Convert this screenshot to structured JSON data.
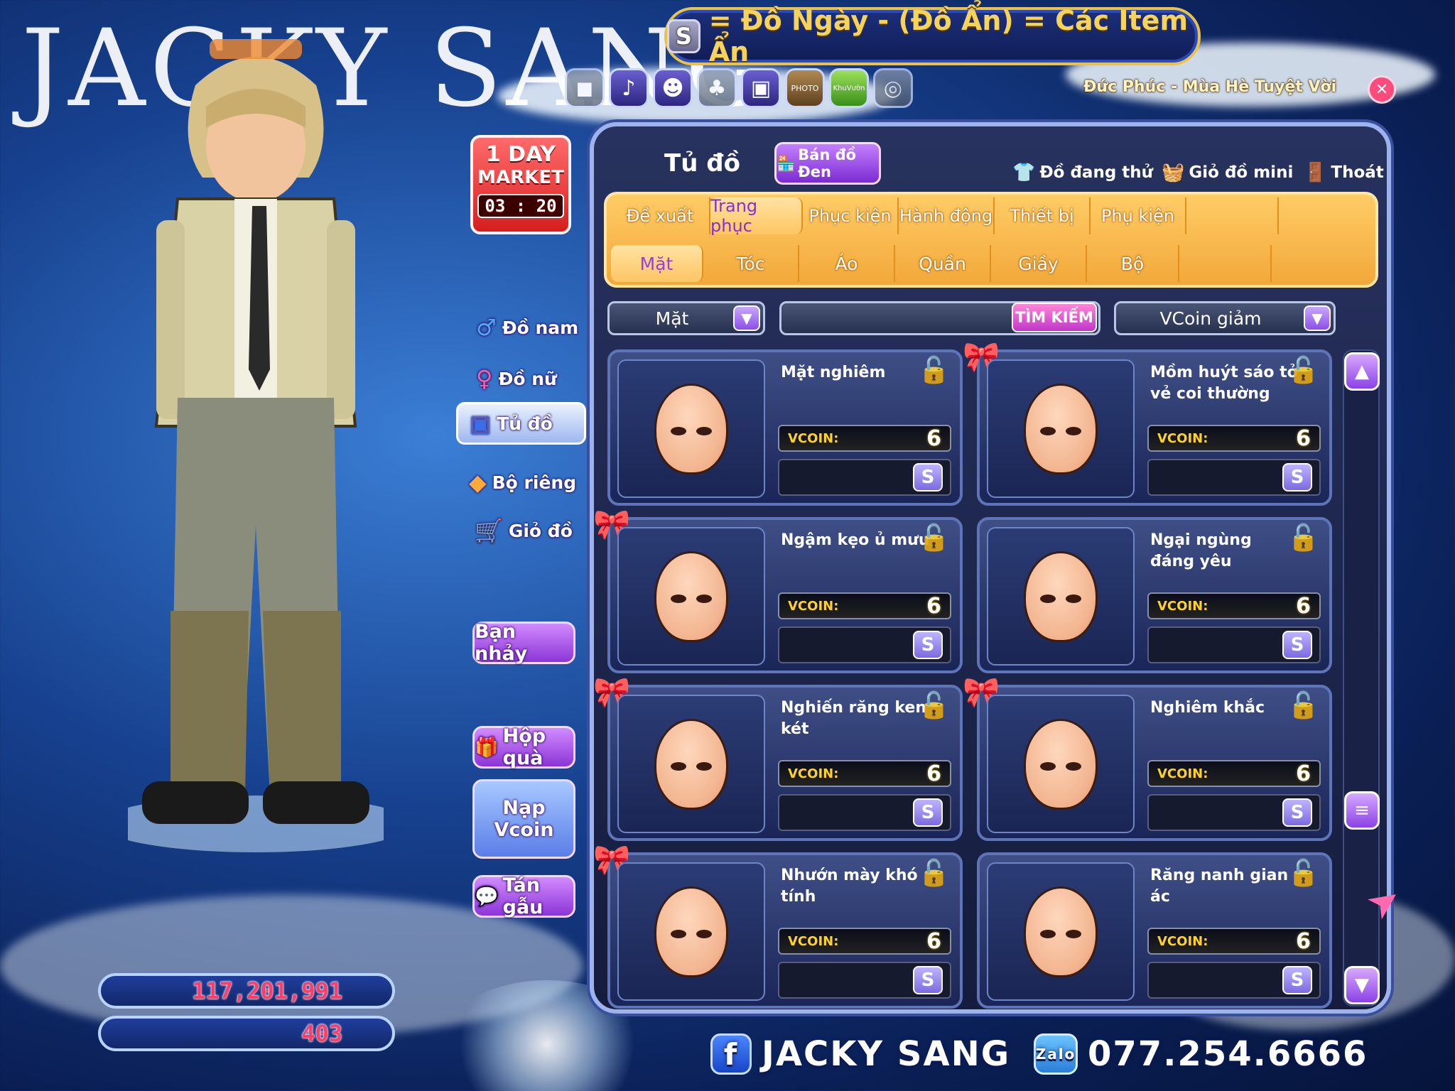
{
  "background": {
    "logo_text": "JACKY SANG"
  },
  "top_banner": {
    "badge": "S",
    "text": "= Đồ Ngày  -  (Đồ Ẩn) = Các Item Ẩn"
  },
  "top_icons": [
    "bag-icon",
    "horn-icon",
    "fish-icon",
    "mask-icon",
    "tv-icon",
    "photo-icon",
    "garden-icon",
    "spiral-icon"
  ],
  "top_icon_labels": {
    "photo": "PHOTO",
    "garden": "KhuVườn"
  },
  "song": "Đức Phúc - Mùa Hè Tuyệt Vời",
  "market": {
    "line1": "1 DAY",
    "line2": "MARKET",
    "timer": "03 : 20"
  },
  "side_menu": {
    "do_nam": "Đồ nam",
    "do_nu": "Đồ nữ",
    "tu_do": "Tủ đồ",
    "bo_rieng": "Bộ riêng",
    "gio_do": "Giỏ đồ"
  },
  "buttons": {
    "ban_nhay": "Bạn nhảy",
    "hop_qua": "Hộp quà",
    "nap_vcoin_1": "Nạp",
    "nap_vcoin_2": "Vcoin",
    "tan_gau": "Tán gẫu"
  },
  "stats": {
    "money": "117,201,991",
    "vcoin": "403"
  },
  "panel": {
    "title": "Tủ đồ",
    "hidden_btn": "Bán đồ Đen",
    "do_dang_thu": "Đồ đang thử",
    "gio_do_mini": "Giỏ đồ mini",
    "thoat": "Thoát"
  },
  "tabs": [
    "Đề xuất",
    "Trang phục",
    "Phục kiện",
    "Hành động",
    "Thiết bị",
    "Phụ kiện"
  ],
  "active_tab": "Trang phục",
  "subtabs": [
    "Mặt",
    "Tóc",
    "Áo",
    "Quần",
    "Giầy",
    "Bộ"
  ],
  "active_subtab": "Mặt",
  "filters": {
    "category": "Mặt",
    "search_button": "TÌM KIẾM",
    "sort": "VCoin giảm"
  },
  "items": [
    {
      "name": "Mặt nghiêm",
      "price_label": "VCOIN:",
      "price": "6",
      "buy": "S"
    },
    {
      "name": "Mồm huýt sáo tỏ vẻ coi thường",
      "price_label": "VCOIN:",
      "price": "6",
      "buy": "S"
    },
    {
      "name": "Ngậm kẹo ủ mưu",
      "price_label": "VCOIN:",
      "price": "6",
      "buy": "S"
    },
    {
      "name": "Ngại ngùng đáng yêu",
      "price_label": "VCOIN:",
      "price": "6",
      "buy": "S"
    },
    {
      "name": "Nghiến răng ken két",
      "price_label": "VCOIN:",
      "price": "6",
      "buy": "S"
    },
    {
      "name": "Nghiêm khắc",
      "price_label": "VCOIN:",
      "price": "6",
      "buy": "S"
    },
    {
      "name": "Nhướn mày khó tính",
      "price_label": "VCOIN:",
      "price": "6",
      "buy": "S"
    },
    {
      "name": "Răng nanh gian ác",
      "price_label": "VCOIN:",
      "price": "6",
      "buy": "S"
    }
  ],
  "footer": {
    "name": "JACKY SANG",
    "zalo": "Zalo",
    "phone": "077.254.6666"
  }
}
